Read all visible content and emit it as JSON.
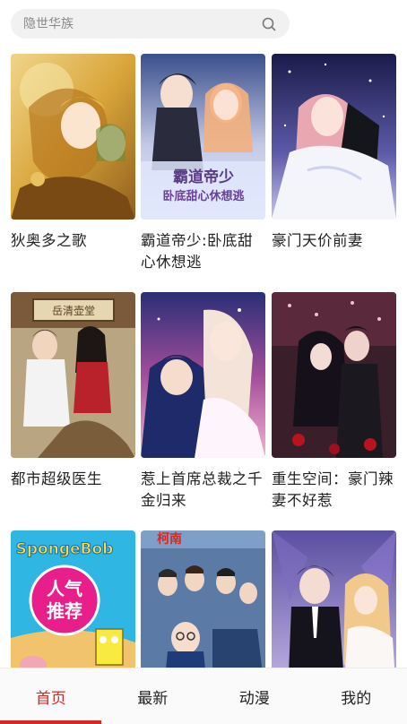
{
  "search": {
    "placeholder": "隐世华族"
  },
  "comics": [
    {
      "title": "狄奥多之歌"
    },
    {
      "title": "霸道帝少:卧底甜心休想逃"
    },
    {
      "title": "豪门天价前妻"
    },
    {
      "title": "都市超级医生"
    },
    {
      "title": "惹上首席总裁之千金归来"
    },
    {
      "title": "重生空间：豪门辣妻不好惹"
    },
    {
      "title": ""
    },
    {
      "title": ""
    },
    {
      "title": ""
    }
  ],
  "covers": {
    "c2_logo": "霸道帝少",
    "c2_sub": "卧底甜心休想逃",
    "c4_sign": "岳清壶堂",
    "c7_brand": "SpongeBob",
    "c7_badge_1": "人气",
    "c7_badge_2": "推荐",
    "c8_brand": "柯南"
  },
  "tabs": [
    {
      "label": "首页",
      "active": true
    },
    {
      "label": "最新",
      "active": false
    },
    {
      "label": "动漫",
      "active": false
    },
    {
      "label": "我的",
      "active": false
    }
  ],
  "colors": {
    "accent": "#d42a21",
    "search_bg": "#f1f1f1"
  }
}
